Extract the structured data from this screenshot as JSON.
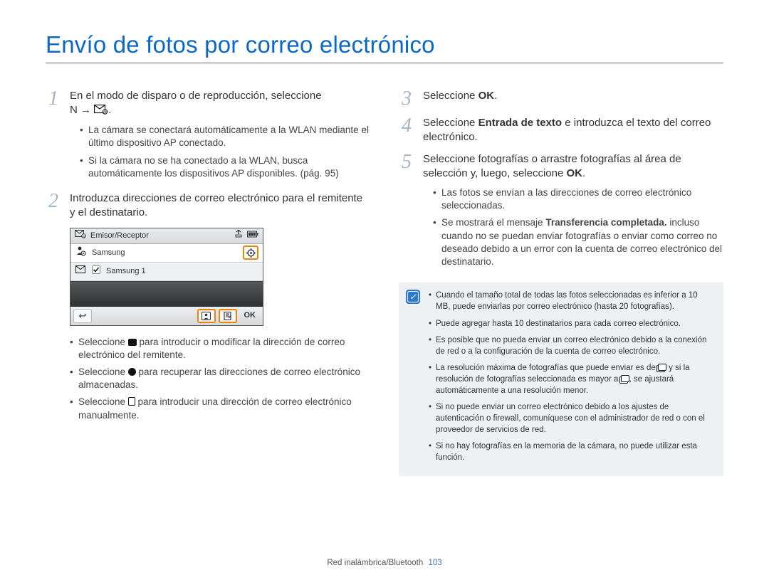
{
  "title": "Envío de fotos por correo electrónico",
  "footer": {
    "section": "Red inalámbrica/Bluetooth",
    "page": "103"
  },
  "left": {
    "step1": {
      "text_a": "En el modo de disparo o de reproducción, seleccione ",
      "n": "N",
      "arrow": "→",
      "dot_after": ".",
      "bullets": [
        "La cámara se conectará automáticamente a la WLAN mediante el último dispositivo AP conectado.",
        "Si la cámara no se ha conectado a la WLAN, busca automáticamente los dispositivos AP disponibles. (pág. 95)"
      ]
    },
    "step2": {
      "text": "Introduzca direcciones de correo electrónico para el remitente y el destinatario."
    },
    "screenshot": {
      "header_title": "Emisor/Receptor",
      "row1_label": "Samsung",
      "row2_label": "Samsung 1",
      "ok": "OK"
    },
    "after_ss_bullets": {
      "b1_a": "Seleccione ",
      "b1_b": " para introducir o modificar la dirección de correo electrónico del remitente.",
      "b2_a": "Seleccione ",
      "b2_b": " para recuperar las direcciones de correo electrónico almacenadas.",
      "b3_a": "Seleccione ",
      "b3_b": " para introducir una dirección de correo electrónico manualmente."
    }
  },
  "right": {
    "step3": {
      "a": "Seleccione ",
      "b": "OK",
      "c": "."
    },
    "step4": {
      "a": "Seleccione ",
      "b": "Entrada de texto",
      "c": " e introduzca el texto del correo electrónico."
    },
    "step5": {
      "a": "Seleccione fotografías o arrastre fotografías al área de selección y, luego, seleccione ",
      "b": "OK",
      "c": ".",
      "bullets_a": "Las fotos se envían a las direcciones de correo electrónico seleccionadas.",
      "bullets_b_a": "Se mostrará el mensaje ",
      "bullets_b_strong": "Transferencia completada.",
      "bullets_b_b": " incluso cuando no se puedan enviar fotografías o enviar como correo no deseado debido a un error con la cuenta de correo electrónico del destinatario."
    },
    "note": {
      "items": [
        "Cuando el tamaño total de todas las fotos seleccionadas es inferior a 10 MB, puede enviarlas por correo electrónico (hasta 20 fotografías).",
        "Puede agregar hasta 10 destinatarios para cada correo electrónico.",
        "Es posible que no pueda enviar un correo electrónico debido a la conexión de red o a la configuración de la cuenta de correo electrónico."
      ],
      "item4_a": "La resolución máxima de fotografías que puede enviar es de ",
      "item4_b": " y si la resolución de fotografías seleccionada es mayor a ",
      "item4_c": ", se ajustará automáticamente a una resolución menor.",
      "items_tail": [
        "Si no puede enviar un correo electrónico debido a los ajustes de autenticación o firewall, comuníquese con el administrador de red o con el proveedor de servicios de red.",
        "Si no hay fotografías en la memoria de la cámara, no puede utilizar esta función."
      ]
    }
  }
}
